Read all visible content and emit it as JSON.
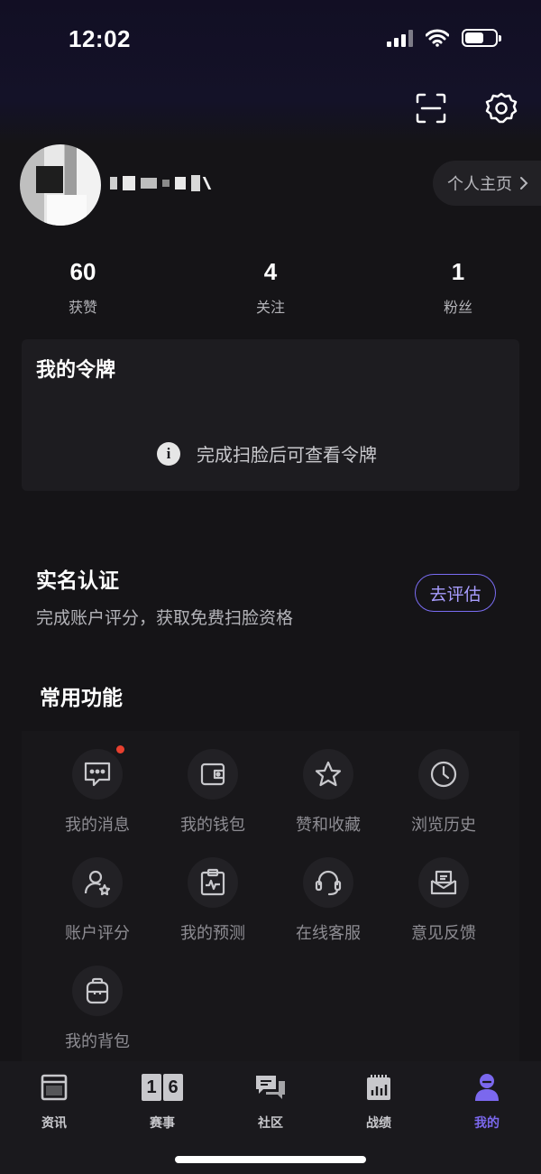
{
  "status_bar": {
    "time": "12:02"
  },
  "profile": {
    "username": "",
    "home_link": "个人主页"
  },
  "stats": [
    {
      "value": "60",
      "label": "获赞"
    },
    {
      "value": "4",
      "label": "关注"
    },
    {
      "value": "1",
      "label": "粉丝"
    }
  ],
  "token_card": {
    "title": "我的令牌",
    "hint": "完成扫脸后可查看令牌"
  },
  "real_name": {
    "title": "实名认证",
    "subtitle": "完成账户评分，获取免费扫脸资格",
    "button": "去评估"
  },
  "features": {
    "title": "常用功能",
    "items": [
      {
        "label": "我的消息",
        "icon": "message-icon",
        "badge": true
      },
      {
        "label": "我的钱包",
        "icon": "wallet-icon"
      },
      {
        "label": "赞和收藏",
        "icon": "star-icon"
      },
      {
        "label": "浏览历史",
        "icon": "clock-icon"
      },
      {
        "label": "账户评分",
        "icon": "user-star-icon"
      },
      {
        "label": "我的预测",
        "icon": "clipboard-pulse-icon"
      },
      {
        "label": "在线客服",
        "icon": "headset-icon"
      },
      {
        "label": "意见反馈",
        "icon": "mail-icon"
      },
      {
        "label": "我的背包",
        "icon": "backpack-icon"
      }
    ]
  },
  "tab_bar": {
    "items": [
      {
        "label": "资讯",
        "icon": "news-icon"
      },
      {
        "label": "赛事",
        "icon": "scoreboard-icon",
        "glyphs": [
          "1",
          "6"
        ]
      },
      {
        "label": "社区",
        "icon": "chat-bubbles-icon"
      },
      {
        "label": "战绩",
        "icon": "stats-icon"
      },
      {
        "label": "我的",
        "icon": "profile-icon",
        "active": true
      }
    ],
    "active_color": "#7b68ee"
  },
  "colors": {
    "background": "#151417",
    "card": "#1d1c20",
    "accent": "#7b68ee",
    "badge": "#e8402f"
  }
}
